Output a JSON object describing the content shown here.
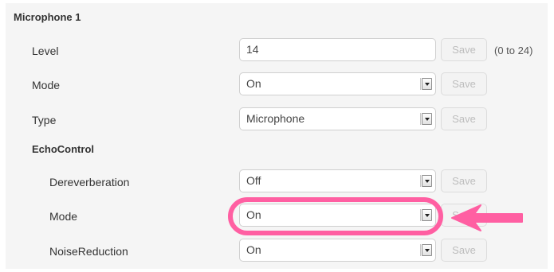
{
  "section": {
    "title": "Microphone 1"
  },
  "echo": {
    "title": "EchoControl"
  },
  "rows": [
    {
      "label": "Level",
      "value": "14",
      "save": "Save",
      "note": "(0 to 24)"
    },
    {
      "label": "Mode",
      "value": "On",
      "save": "Save"
    },
    {
      "label": "Type",
      "value": "Microphone",
      "save": "Save"
    },
    {
      "label": "Dereverberation",
      "value": "Off",
      "save": "Save"
    },
    {
      "label": "Mode",
      "value": "On",
      "save": "Save"
    },
    {
      "label": "NoiseReduction",
      "value": "On",
      "save": "Save"
    }
  ],
  "colors": {
    "annotation": "#ff5fa2",
    "panel": "#f5f5f5"
  },
  "icons": {
    "select": "chevron-down-icon",
    "annotation": "arrow-left-icon"
  }
}
